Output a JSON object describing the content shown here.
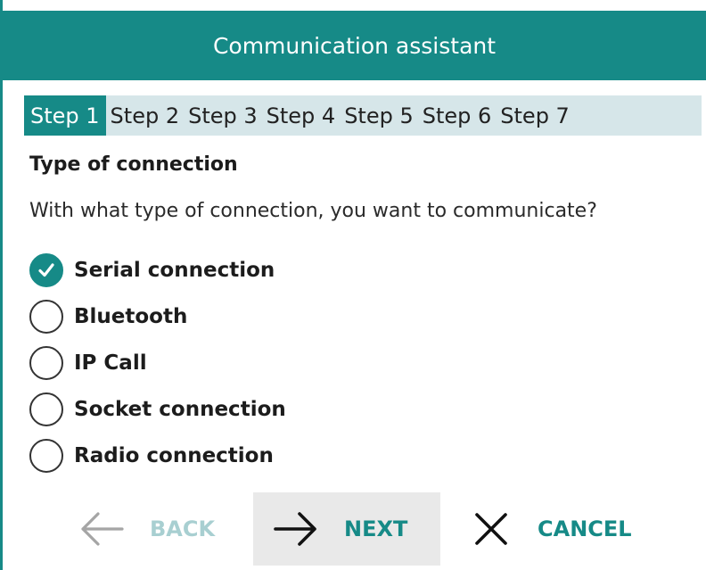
{
  "window": {
    "title": "Communication assistant"
  },
  "steps": [
    {
      "label": "Step 1",
      "active": true
    },
    {
      "label": "Step 2",
      "active": false
    },
    {
      "label": "Step 3",
      "active": false
    },
    {
      "label": "Step 4",
      "active": false
    },
    {
      "label": "Step 5",
      "active": false
    },
    {
      "label": "Step 6",
      "active": false
    },
    {
      "label": "Step 7",
      "active": false
    }
  ],
  "content": {
    "heading": "Type of connection",
    "question": "With what type of connection, you want to communicate?",
    "options": [
      {
        "label": "Serial connection",
        "checked": true
      },
      {
        "label": "Bluetooth",
        "checked": false
      },
      {
        "label": "IP Call",
        "checked": false
      },
      {
        "label": "Socket connection",
        "checked": false
      },
      {
        "label": "Radio connection",
        "checked": false
      }
    ]
  },
  "footer": {
    "back_label": "BACK",
    "next_label": "NEXT",
    "cancel_label": "CANCEL"
  },
  "icons": {
    "back": "arrow-left-icon",
    "next": "arrow-right-icon",
    "cancel": "close-icon",
    "checked": "checkmark-icon"
  },
  "colors": {
    "accent": "#168a87",
    "step_bar": "#d6e6e9",
    "disabled": "#a8cfd1",
    "next_bg": "#e9e9e9"
  }
}
